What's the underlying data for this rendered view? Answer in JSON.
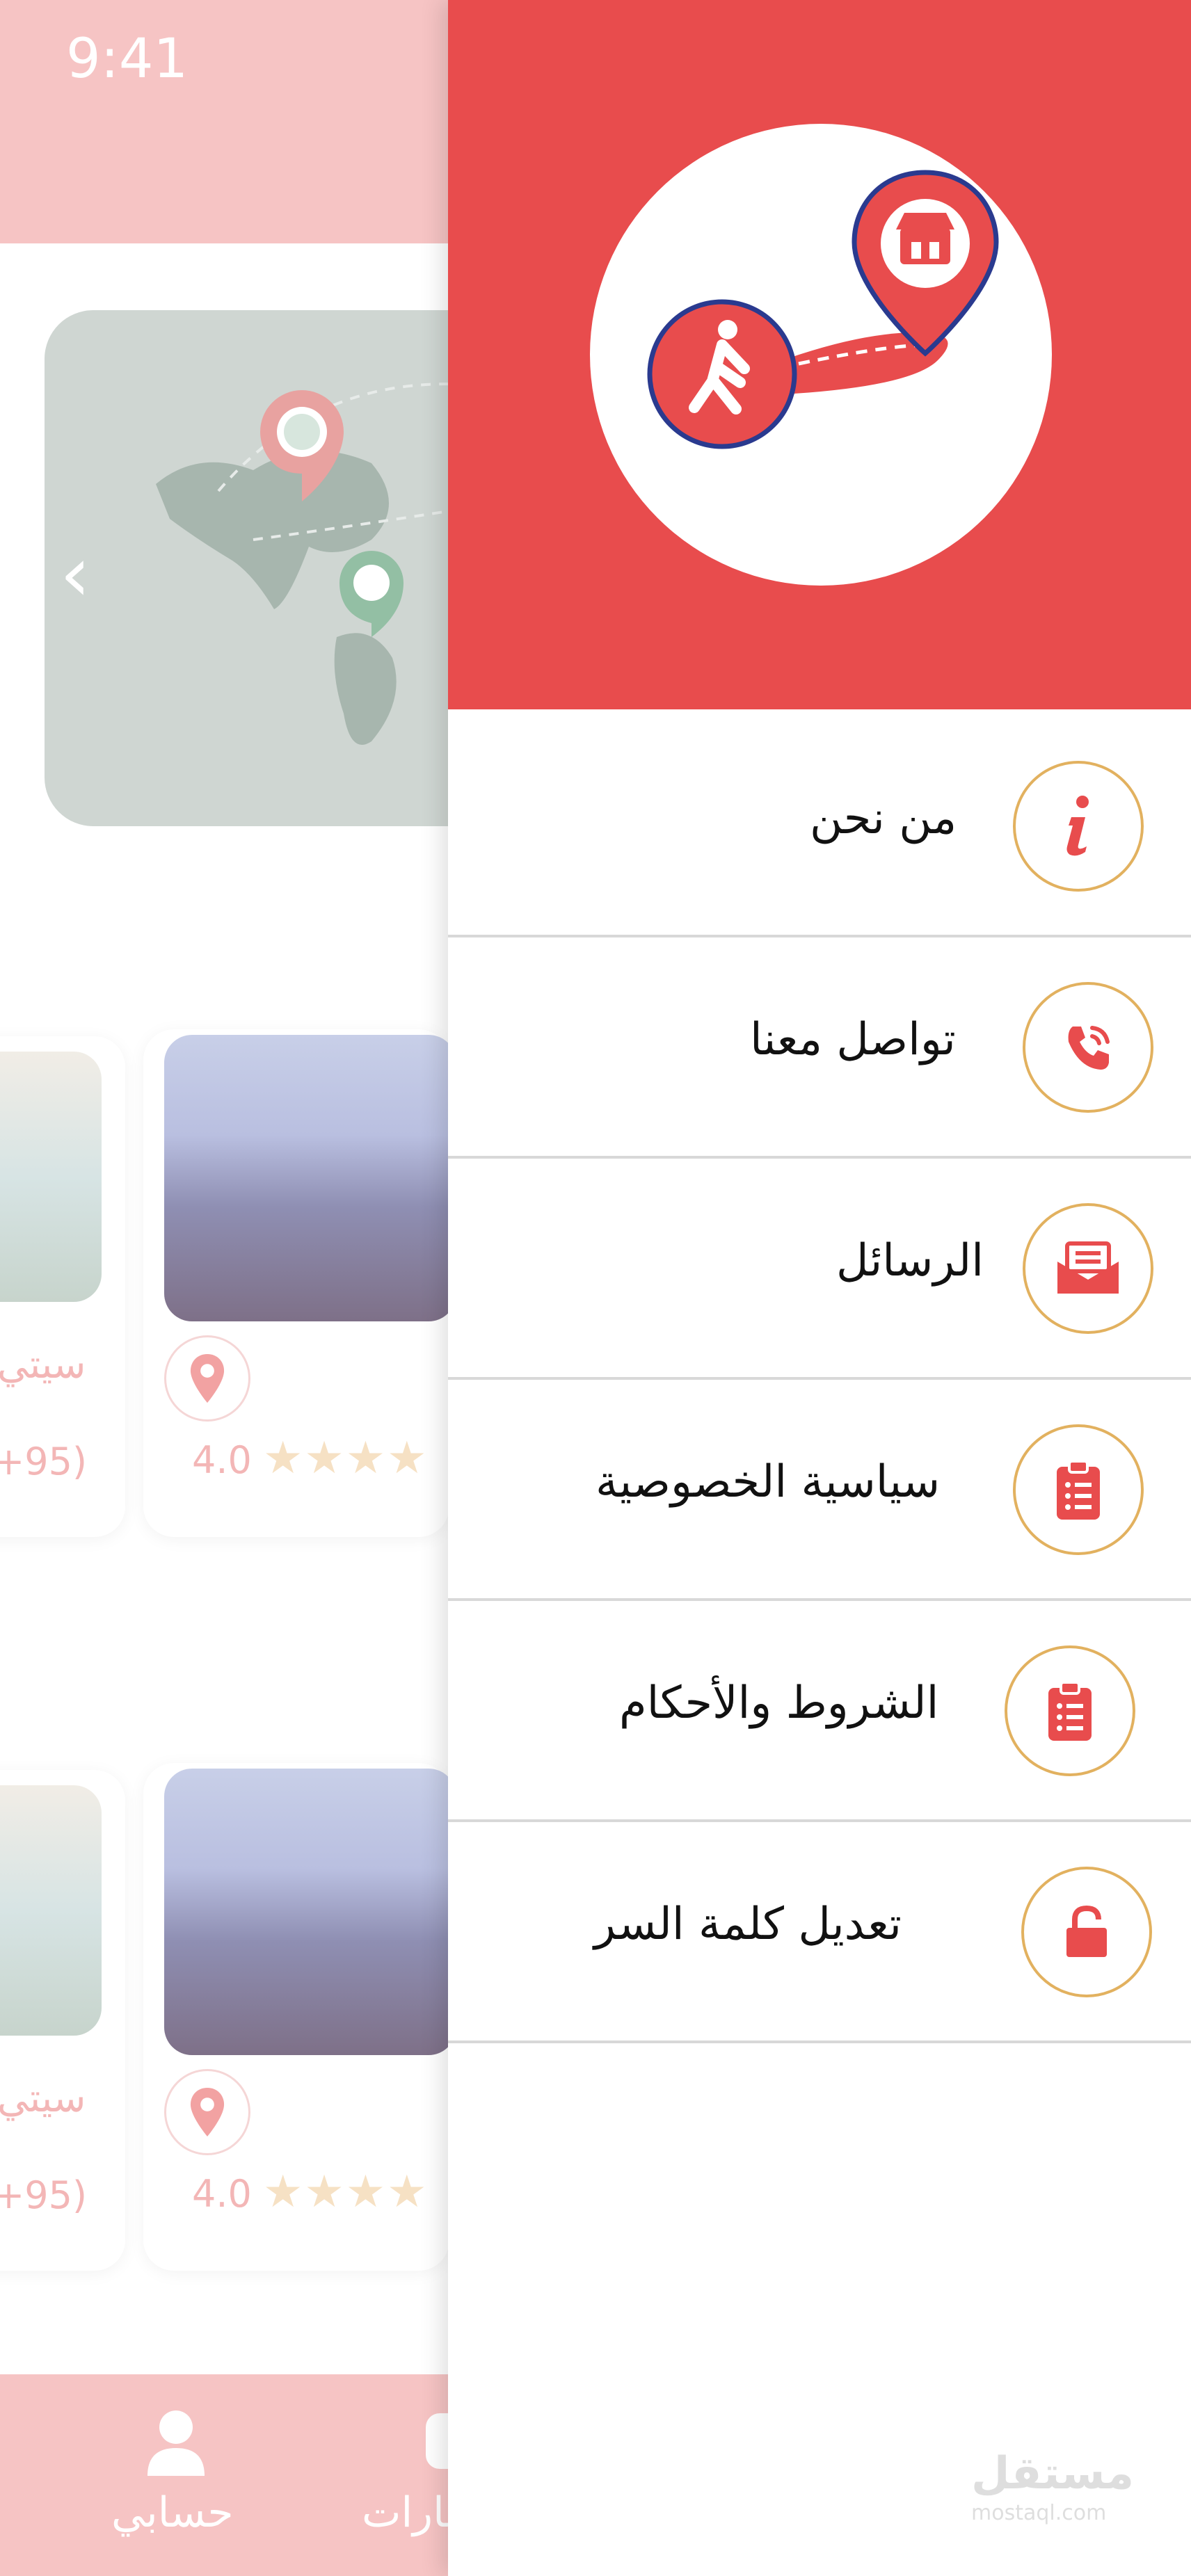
{
  "status_bar": {
    "time": "9:41"
  },
  "banner": {
    "arrow": "‹"
  },
  "cards": [
    {
      "rating": "4.0",
      "stars": "★★★★",
      "name": "",
      "count": ""
    },
    {
      "rating": "",
      "stars": "",
      "name": "سيتي",
      "count": "+95)"
    },
    {
      "rating": "4.0",
      "stars": "★★★★",
      "name": "",
      "count": ""
    },
    {
      "rating": "",
      "stars": "",
      "name": "سيتي",
      "count": "+95)"
    }
  ],
  "bottom_nav": {
    "account_label": "حسابي",
    "second_label": "عارات"
  },
  "drawer": {
    "menu": [
      {
        "label": "من نحن",
        "icon": "info-icon"
      },
      {
        "label": "تواصل معنا",
        "icon": "phone-icon"
      },
      {
        "label": "الرسائل",
        "icon": "mail-icon"
      },
      {
        "label": "سياسية الخصوصية",
        "icon": "clipboard-icon"
      },
      {
        "label": "الشروط والأحكام",
        "icon": "clipboard-icon"
      },
      {
        "label": "تعديل كلمة السر",
        "icon": "lock-icon"
      }
    ]
  },
  "watermark": {
    "arabic": "مستقل",
    "latin": "mostaql.com"
  },
  "colors": {
    "accent_red": "#e84c4d",
    "icon_ring_gold": "#e2b15f",
    "bg_pink": "#f6c4c4",
    "logo_navy": "#2a3a8f"
  }
}
